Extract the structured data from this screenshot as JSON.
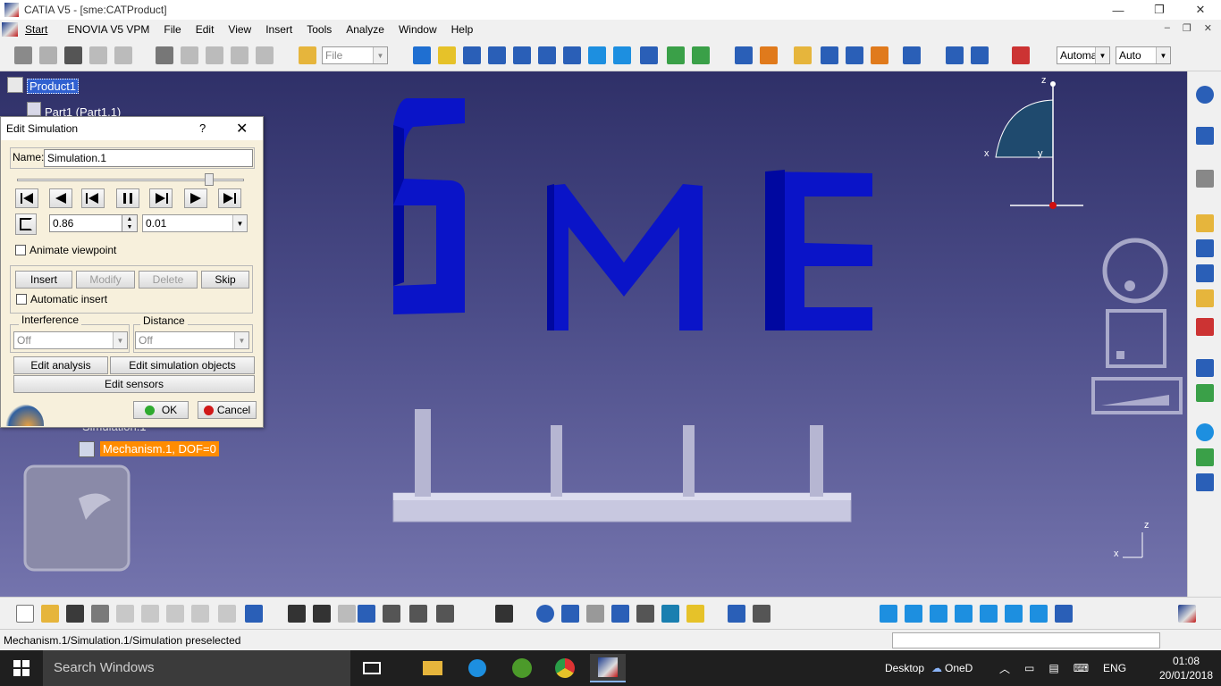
{
  "window": {
    "title": "CATIA V5 - [sme:CATProduct]",
    "minimize": "—",
    "maximize": "❐",
    "close": "✕"
  },
  "menubar": {
    "items": [
      "Start",
      "ENOVIA V5 VPM",
      "File",
      "Edit",
      "View",
      "Insert",
      "Tools",
      "Analyze",
      "Window",
      "Help"
    ],
    "mdi": [
      "–",
      "❐",
      "✕"
    ]
  },
  "toolbar": {
    "file_combo": "File",
    "render_combo": "Automa",
    "auto_combo": "Auto"
  },
  "tree": {
    "root": "Product1",
    "part": "Part1 (Part1.1)",
    "simulation": "Simulation.1",
    "mechanism": "Mechanism.1, DOF=0"
  },
  "dialog": {
    "title": "Edit Simulation",
    "help": "?",
    "close": "✕",
    "name_label": "Name:",
    "name_value": "Simulation.1",
    "slider_position": 0.86,
    "step_value": "0.86",
    "step_combo": "0.01",
    "animate_viewpoint": "Animate viewpoint",
    "insert": "Insert",
    "modify": "Modify",
    "delete": "Delete",
    "skip": "Skip",
    "automatic_insert": "Automatic insert",
    "interference_label": "Interference",
    "interference_value": "Off",
    "distance_label": "Distance",
    "distance_value": "Off",
    "edit_analysis": "Edit analysis",
    "edit_simulation_objects": "Edit simulation objects",
    "edit_sensors": "Edit sensors",
    "ok": "OK",
    "cancel": "Cancel"
  },
  "compass": {
    "x": "x",
    "y": "y",
    "z": "z"
  },
  "axis_mini": {
    "x": "x",
    "z": "z"
  },
  "status": {
    "text": "Mechanism.1/Simulation.1/Simulation preselected"
  },
  "taskbar": {
    "search": "Search Windows",
    "desktop": "Desktop",
    "onedrive": "OneD",
    "lang": "ENG",
    "time": "01:08",
    "date": "20/01/2018"
  },
  "colors": {
    "letters": "#0a14c8",
    "viewport_top": "#2f3068",
    "viewport_bottom": "#7474ad",
    "selection": "#ff8c00"
  }
}
